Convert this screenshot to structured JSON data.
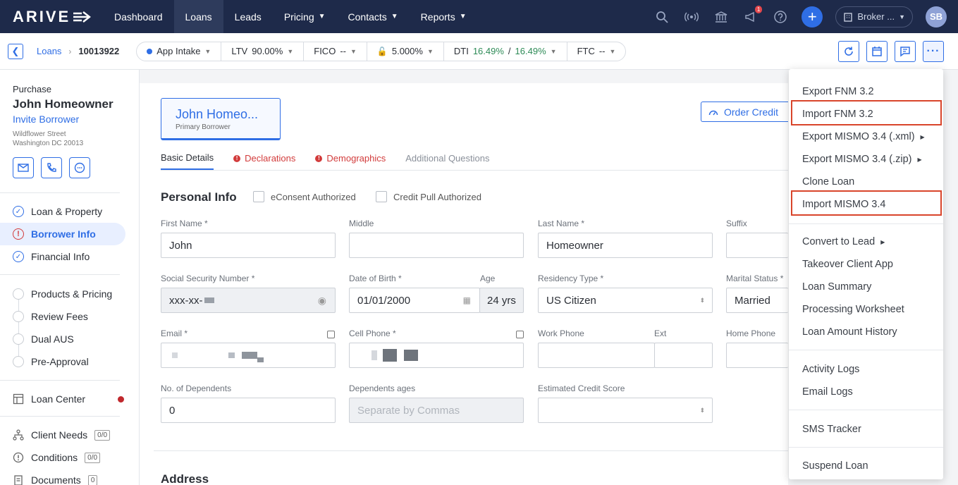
{
  "app": {
    "logo": "ARIVE"
  },
  "nav": {
    "items": [
      {
        "label": "Dashboard",
        "chevron": false
      },
      {
        "label": "Loans",
        "chevron": false
      },
      {
        "label": "Leads",
        "chevron": false
      },
      {
        "label": "Pricing",
        "chevron": true
      },
      {
        "label": "Contacts",
        "chevron": true
      },
      {
        "label": "Reports",
        "chevron": true
      }
    ],
    "notification_count": "1",
    "broker_label": "Broker ...",
    "avatar_initials": "SB"
  },
  "subbar": {
    "crumb_link": "Loans",
    "loan_id": "10013922",
    "status": "App Intake",
    "ltv_label": "LTV",
    "ltv_value": "90.00%",
    "fico_label": "FICO",
    "fico_value": "--",
    "rate_value": "5.000%",
    "dti_label": "DTI",
    "dti_front": "16.49%",
    "dti_sep": "/",
    "dti_back": "16.49%",
    "ftc_label": "FTC",
    "ftc_value": "--"
  },
  "sidebar": {
    "purpose": "Purchase",
    "borrower_name": "John Homeowner",
    "invite": "Invite Borrower",
    "address_line1": "Wildflower Street",
    "address_line2": "Washington DC 20013",
    "steps": [
      {
        "label": "Loan & Property",
        "state": "done"
      },
      {
        "label": "Borrower Info",
        "state": "warning"
      },
      {
        "label": "Financial Info",
        "state": "done"
      }
    ],
    "pricing_steps": [
      "Products & Pricing",
      "Review Fees",
      "Dual AUS",
      "Pre-Approval"
    ],
    "loan_center": "Loan Center",
    "client_needs": "Client Needs",
    "client_needs_count": "0/0",
    "conditions": "Conditions",
    "conditions_count": "0/0",
    "documents": "Documents",
    "documents_count": "0"
  },
  "main": {
    "borrower_card_name": "John Homeo...",
    "borrower_card_role": "Primary Borrower",
    "order_credit": "Order Credit",
    "tabs": [
      {
        "label": "Basic Details",
        "state": "active"
      },
      {
        "label": "Declarations",
        "state": "warning"
      },
      {
        "label": "Demographics",
        "state": "warning"
      },
      {
        "label": "Additional Questions",
        "state": "normal"
      }
    ],
    "personal_info_title": "Personal Info",
    "econsent": "eConsent Authorized",
    "credit_pull": "Credit Pull Authorized",
    "labels": {
      "first_name": "First Name *",
      "middle": "Middle",
      "last_name": "Last Name *",
      "suffix": "Suffix",
      "ssn": "Social Security Number *",
      "dob": "Date of Birth *",
      "age": "Age",
      "residency": "Residency Type *",
      "marital": "Marital Status *",
      "email": "Email *",
      "cell": "Cell Phone *",
      "work": "Work Phone",
      "ext": "Ext",
      "home": "Home Phone",
      "dependents": "No. of Dependents",
      "dependents_ages": "Dependents ages",
      "est_credit": "Estimated Credit Score"
    },
    "values": {
      "first_name": "John",
      "last_name": "Homeowner",
      "ssn_prefix": "xxx-xx-",
      "dob": "01/01/2000",
      "age": "24 yrs",
      "residency": "US Citizen",
      "marital": "Married",
      "dependents": "0"
    },
    "placeholders": {
      "dependents_ages": "Separate by Commas"
    },
    "address_title": "Address"
  },
  "menu": {
    "items": [
      {
        "label": "Export FNM 3.2",
        "submenu": false,
        "highlighted": false
      },
      {
        "label": "Import FNM 3.2",
        "submenu": false,
        "highlighted": true
      },
      {
        "label": "Export MISMO 3.4 (.xml)",
        "submenu": true,
        "highlighted": false
      },
      {
        "label": "Export MISMO 3.4 (.zip)",
        "submenu": true,
        "highlighted": false
      },
      {
        "label": "Clone Loan",
        "submenu": false,
        "highlighted": false
      },
      {
        "label": "Import MISMO 3.4",
        "submenu": false,
        "highlighted": true
      },
      {
        "label": "Convert to Lead",
        "submenu": true,
        "highlighted": false
      },
      {
        "label": "Takeover Client App",
        "submenu": false,
        "highlighted": false
      },
      {
        "label": "Loan Summary",
        "submenu": false,
        "highlighted": false
      },
      {
        "label": "Processing Worksheet",
        "submenu": false,
        "highlighted": false
      },
      {
        "label": "Loan Amount History",
        "submenu": false,
        "highlighted": false
      },
      {
        "label": "Activity Logs",
        "submenu": false,
        "highlighted": false
      },
      {
        "label": "Email Logs",
        "submenu": false,
        "highlighted": false
      },
      {
        "label": "SMS Tracker",
        "submenu": false,
        "highlighted": false
      },
      {
        "label": "Suspend Loan",
        "submenu": false,
        "highlighted": false
      }
    ]
  },
  "colors": {
    "nav_bg": "#1e2a4a",
    "accent": "#2f6ee5",
    "warning": "#d23b3b",
    "highlight_box": "#d9452b",
    "positive": "#2e8b57"
  }
}
